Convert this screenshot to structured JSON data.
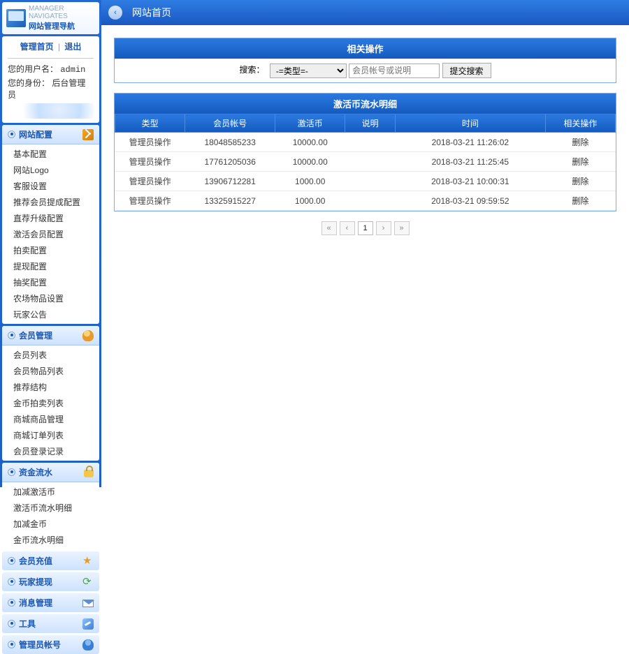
{
  "siteHeader": {
    "subtitle": "MANAGER NAVIGATES",
    "title": "网站管理导航"
  },
  "topLinks": {
    "home": "管理首页",
    "sep": "|",
    "logout": "退出"
  },
  "userInfo": {
    "userLabel": "您的用户名：",
    "userValue": "admin",
    "roleLabel": "您的身份：",
    "roleValue": "后台管理员"
  },
  "groups": [
    {
      "title": "网站配置",
      "icon": "tools",
      "open": true,
      "items": [
        "基本配置",
        "网站Logo",
        "客服设置",
        "推荐会员提成配置",
        "直荐升级配置",
        "激活会员配置",
        "拍卖配置",
        "提现配置",
        "抽奖配置",
        "农场物品设置",
        "玩家公告"
      ]
    },
    {
      "title": "会员管理",
      "icon": "users",
      "open": true,
      "items": [
        "会员列表",
        "会员物品列表",
        "推荐结构",
        "金币拍卖列表",
        "商城商品管理",
        "商城订单列表",
        "会员登录记录"
      ]
    },
    {
      "title": "资金流水",
      "icon": "lock",
      "open": true,
      "items": [
        "加减激活币",
        "激活币流水明细",
        "加减金币",
        "金币流水明细"
      ]
    },
    {
      "title": "会员充值",
      "icon": "star",
      "open": false,
      "items": []
    },
    {
      "title": "玩家提现",
      "icon": "refresh",
      "open": false,
      "items": []
    },
    {
      "title": "消息管理",
      "icon": "mail",
      "open": false,
      "items": []
    },
    {
      "title": "工具",
      "icon": "wrench",
      "open": false,
      "items": []
    },
    {
      "title": "管理员帐号",
      "icon": "user",
      "open": false,
      "items": []
    }
  ],
  "breadcrumb": "网站首页",
  "searchPanel": {
    "title": "相关操作",
    "label": "搜索：",
    "selectValue": "-=类型=-",
    "placeholder": "会员帐号或说明",
    "button": "提交搜索"
  },
  "tablePanel": {
    "title": "激活币流水明细",
    "columns": [
      "类型",
      "会员帐号",
      "激活币",
      "说明",
      "时间",
      "相关操作"
    ],
    "deleteLabel": "删除",
    "rows": [
      {
        "type": "管理员操作",
        "account": "18048585233",
        "amount": "10000.00",
        "note": "",
        "time": "2018-03-21 11:26:02"
      },
      {
        "type": "管理员操作",
        "account": "17761205036",
        "amount": "10000.00",
        "note": "",
        "time": "2018-03-21 11:25:45"
      },
      {
        "type": "管理员操作",
        "account": "13906712281",
        "amount": "1000.00",
        "note": "",
        "time": "2018-03-21 10:00:31"
      },
      {
        "type": "管理员操作",
        "account": "13325915227",
        "amount": "1000.00",
        "note": "",
        "time": "2018-03-21 09:59:52"
      }
    ]
  },
  "pager": {
    "first": "«",
    "prev": "‹",
    "current": "1",
    "next": "›",
    "last": "»"
  }
}
